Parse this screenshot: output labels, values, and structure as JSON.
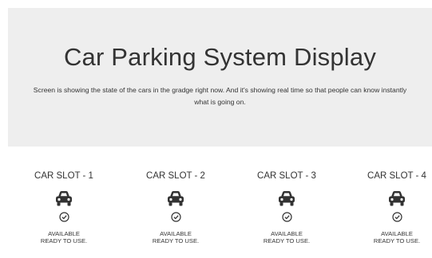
{
  "hero": {
    "title": "Car Parking System Display",
    "description": "Screen is showing the state of the cars in the gradge right now. And it's showing real time so that people can know instantly what is going on."
  },
  "slots": [
    {
      "title": "CAR SLOT - 1",
      "status_line1": "AVAILABLE",
      "status_line2": "READY TO USE.",
      "icon": "car-icon",
      "status_icon": "check-circle-icon"
    },
    {
      "title": "CAR SLOT - 2",
      "status_line1": "AVAILABLE",
      "status_line2": "READY TO USE.",
      "icon": "car-icon",
      "status_icon": "check-circle-icon"
    },
    {
      "title": "CAR SLOT - 3",
      "status_line1": "AVAILABLE",
      "status_line2": "READY TO USE.",
      "icon": "car-icon",
      "status_icon": "check-circle-icon"
    },
    {
      "title": "CAR SLOT - 4",
      "status_line1": "AVAILABLE",
      "status_line2": "READY TO USE.",
      "icon": "car-icon",
      "status_icon": "check-circle-icon"
    }
  ],
  "colors": {
    "hero_background": "#eeeeee",
    "text": "#333333",
    "icon": "#333333"
  }
}
